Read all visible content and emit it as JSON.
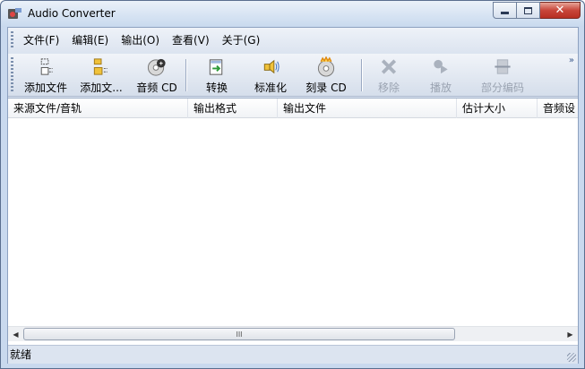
{
  "window": {
    "title": "Audio Converter",
    "minimize": "▭",
    "maximize": "□",
    "close": "✕"
  },
  "menubar": {
    "items": [
      "文件(F)",
      "编辑(E)",
      "输出(O)",
      "查看(V)",
      "关于(G)"
    ]
  },
  "toolbar": {
    "buttons": [
      {
        "label": "添加文件",
        "icon": "add-file-icon",
        "enabled": true
      },
      {
        "label": "添加文...",
        "icon": "add-folder-icon",
        "enabled": true
      },
      {
        "label": "音频 CD",
        "icon": "audio-cd-icon",
        "enabled": true
      },
      {
        "label": "转换",
        "icon": "convert-icon",
        "enabled": true
      },
      {
        "label": "标准化",
        "icon": "normalize-icon",
        "enabled": true
      },
      {
        "label": "刻录 CD",
        "icon": "burn-cd-icon",
        "enabled": true
      },
      {
        "label": "移除",
        "icon": "remove-icon",
        "enabled": false
      },
      {
        "label": "播放",
        "icon": "play-icon",
        "enabled": false
      },
      {
        "label": "部分编码",
        "icon": "partial-encode-icon",
        "enabled": false
      }
    ],
    "overflow": "»"
  },
  "list": {
    "columns": [
      "来源文件/音轨",
      "输出格式",
      "输出文件",
      "估计大小",
      "音频设"
    ]
  },
  "scrollbar": {
    "left": "◀",
    "right": "▶",
    "grip": "III"
  },
  "status": {
    "text": "就绪"
  },
  "colors": {
    "disabled_text": "#9aa3b1",
    "close_button": "#c8463a",
    "frame": "#c9d9ee"
  }
}
